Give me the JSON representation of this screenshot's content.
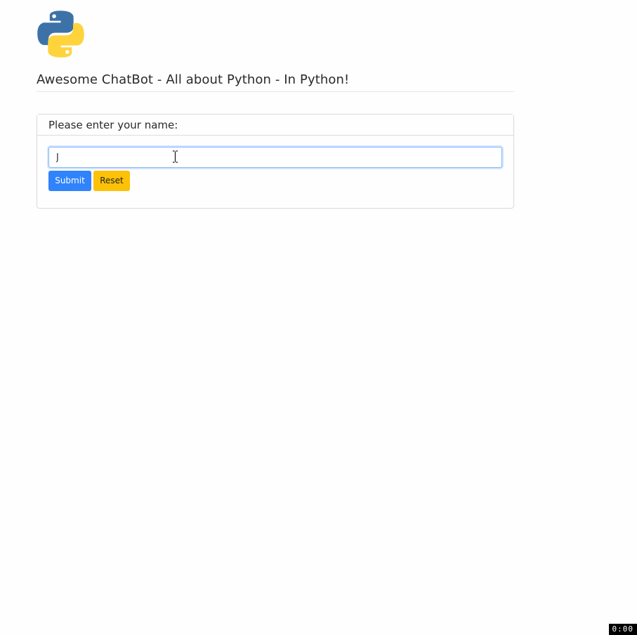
{
  "header": {
    "logo_icon": "python-logo-icon",
    "title": "Awesome ChatBot - All about Python - In Python!"
  },
  "form": {
    "prompt": "Please enter your name:",
    "name_value": "J",
    "submit_label": "Submit",
    "reset_label": "Reset"
  },
  "overlay": {
    "timer": "0:00",
    "cursor_icon": "text-cursor-icon"
  },
  "colors": {
    "submit": "#3083fb",
    "reset": "#fdc107",
    "python_blue": "#3c72a8",
    "python_yellow": "#fed33c"
  }
}
